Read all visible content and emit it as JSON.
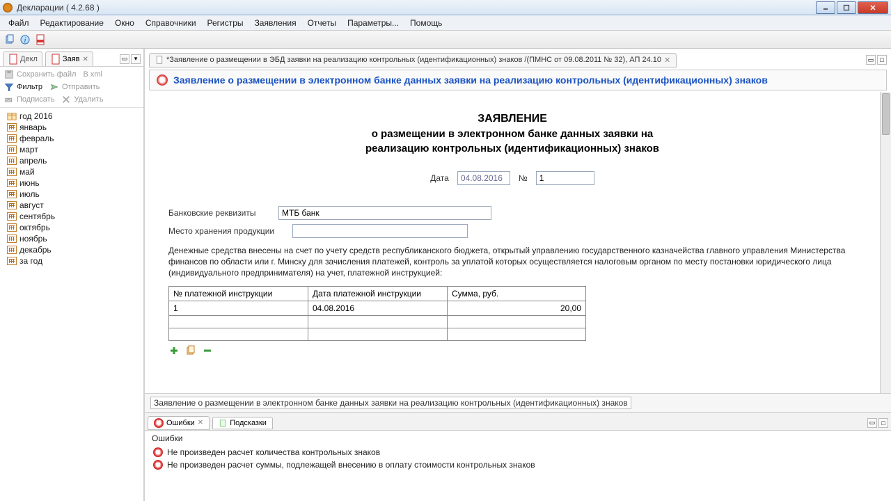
{
  "window": {
    "title": "Декларации ( 4.2.68 )"
  },
  "menu": {
    "items": [
      "Файл",
      "Редактирование",
      "Окно",
      "Справочники",
      "Регистры",
      "Заявления",
      "Отчеты",
      "Параметры...",
      "Помощь"
    ]
  },
  "sidebar": {
    "tabs": {
      "decl": "Декл",
      "app": "Заяв"
    },
    "actions": {
      "save": "Сохранить файл",
      "xml": "В xml",
      "filter": "Фильтр",
      "send": "Отправить",
      "sign": "Подписать",
      "delete": "Удалить"
    },
    "tree": {
      "year": "год 2016",
      "months": [
        "январь",
        "февраль",
        "март",
        "апрель",
        "май",
        "июнь",
        "июль",
        "август",
        "сентябрь",
        "октябрь",
        "ноябрь",
        "декабрь",
        "за год"
      ]
    }
  },
  "doc": {
    "tab_title": "*Заявление о размещении в ЭБД заявки на реализацию контрольных (идентификационных) знаков /(ПМНС от 09.08.2011 № 32), АП 24.10",
    "banner": "Заявление о размещении в электронном банке данных заявки на реализацию контрольных (идентификационных) знаков",
    "heading_main": "ЗАЯВЛЕНИЕ",
    "heading_sub1": "о размещении в электронном банке данных заявки на",
    "heading_sub2": "реализацию контрольных (идентификационных) знаков",
    "labels": {
      "date": "Дата",
      "number": "№",
      "bank": "Банковские реквизиты",
      "storage": "Место хранения продукции"
    },
    "fields": {
      "date": "04.08.2016",
      "number": "1",
      "bank": "МТБ банк",
      "storage": ""
    },
    "longtext": "Денежные средства внесены на счет по учету средств республиканского бюджета, открытый управлению государственного казначейства главного управления Министерства финансов по области или г. Минску для зачисления платежей, контроль за уплатой которых осуществляется налоговым органом по месту постановки юридического лица (индивидуального предпринимателя) на учет, платежной инструкцией:",
    "grid": {
      "cols": [
        "№ платежной инструкции",
        "Дата платежной инструкции",
        "Сумма, руб."
      ],
      "rows": [
        {
          "num": "1",
          "date": "04.08.2016",
          "sum": "20,00"
        }
      ]
    },
    "status": "Заявление о размещении в электронном банке данных заявки на реализацию контрольных (идентификационных) знаков"
  },
  "bottom": {
    "tab_errors": "Ошибки",
    "tab_hints": "Подсказки",
    "errors_header": "Ошибки",
    "errors": [
      "Не произведен расчет количества контрольных знаков",
      "Не произведен расчет суммы, подлежащей внесению в оплату стоимости контрольных знаков"
    ]
  }
}
